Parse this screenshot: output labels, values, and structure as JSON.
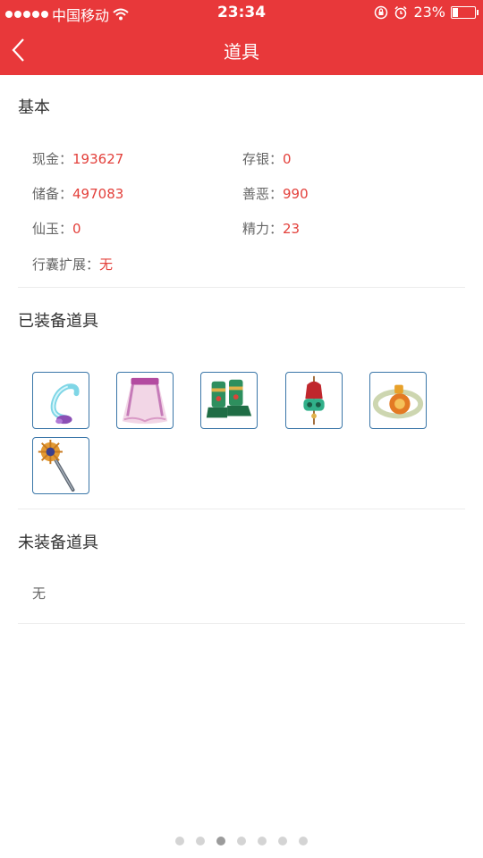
{
  "status_bar": {
    "carrier": "中国移动",
    "time": "23:34",
    "battery": "23%",
    "battery_level": 0.23
  },
  "header": {
    "title": "道具"
  },
  "basic": {
    "title": "基本",
    "stats": [
      {
        "label": "现金：",
        "value": "193627"
      },
      {
        "label": "存银：",
        "value": "0"
      },
      {
        "label": "储备：",
        "value": "497083"
      },
      {
        "label": "善恶：",
        "value": "990"
      },
      {
        "label": "仙玉：",
        "value": "0"
      },
      {
        "label": "精力：",
        "value": "23"
      },
      {
        "label": "行囊扩展：",
        "value": "无"
      }
    ]
  },
  "equipped": {
    "title": "已装备道具",
    "items": [
      "hook-item-icon",
      "skirt-item-icon",
      "boots-item-icon",
      "amulet-item-icon",
      "ring-item-icon",
      "staff-item-icon"
    ]
  },
  "unequipped": {
    "title": "未装备道具",
    "empty_text": "无"
  },
  "pagination": {
    "total": 7,
    "active_index": 2
  },
  "colors": {
    "accent": "#e8383a",
    "value": "#e3403b",
    "item_border": "#3a76a8"
  }
}
